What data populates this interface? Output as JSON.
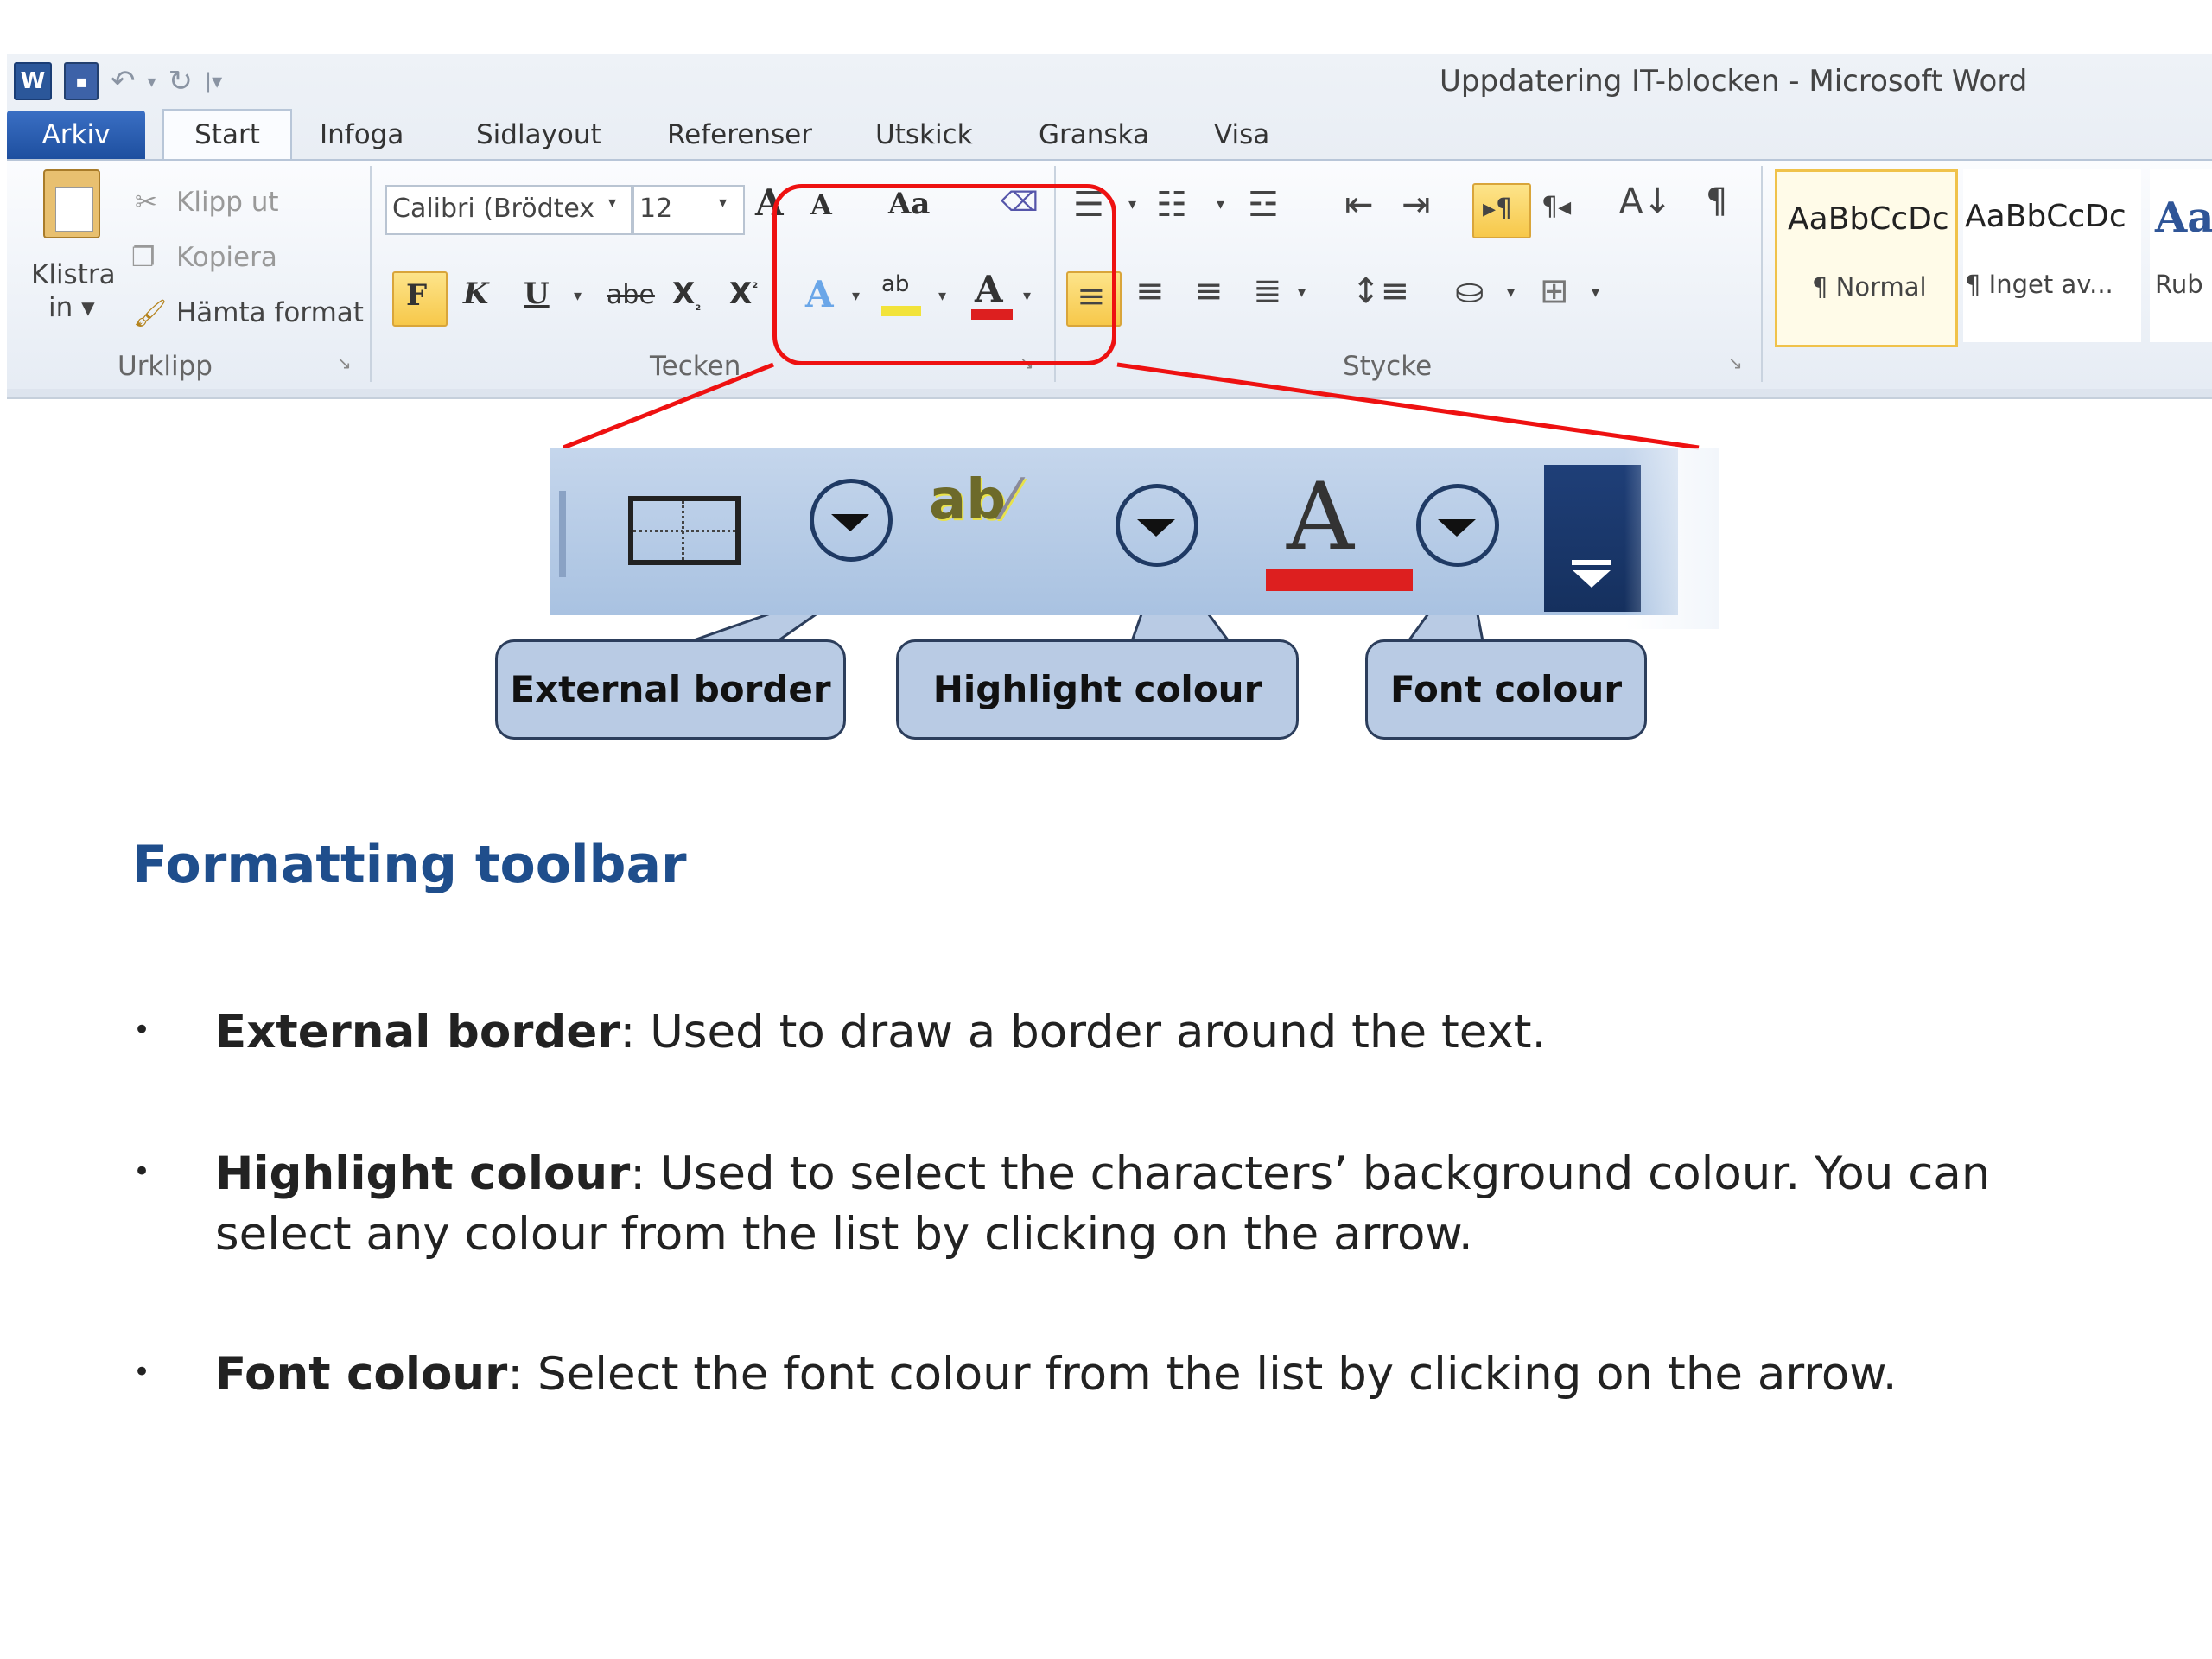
{
  "window": {
    "title": "Uppdatering IT-blocken  -  Microsoft Word"
  },
  "tabs": [
    "Arkiv",
    "Start",
    "Infoga",
    "Sidlayout",
    "Referenser",
    "Utskick",
    "Granska",
    "Visa"
  ],
  "clipboard": {
    "paste_line1": "Klistra",
    "paste_line2": "in ▾",
    "cut": "Klipp ut",
    "copy": "Kopiera",
    "format_painter": "Hämta format",
    "group_label": "Urklipp"
  },
  "font": {
    "font_name": "Calibri (Brödtex",
    "font_size": "12",
    "bold": "F",
    "italic": "K",
    "underline": "U",
    "strike": "abe",
    "grow": "A",
    "shrink": "A",
    "change_case": "Aa",
    "highlight": "ab",
    "font_color": "A",
    "group_label": "Tecken"
  },
  "paragraph": {
    "group_label": "Stycke"
  },
  "styles": [
    {
      "sample": "AaBbCcDc",
      "name": "¶ Normal"
    },
    {
      "sample": "AaBbCcDc",
      "name": "¶ Inget av..."
    },
    {
      "sample": "AaI",
      "name": "Rub"
    }
  ],
  "zoom": {
    "highlight_glyph": "ab",
    "font_glyph": "A"
  },
  "callouts": [
    "External border",
    "Highlight colour",
    "Font colour"
  ],
  "content": {
    "heading": "Formatting toolbar",
    "bullets": [
      {
        "term": "External border",
        "text": ": Used to draw a border around the text."
      },
      {
        "term": "Highlight colour",
        "text": ": Used to select the characters’ background colour. You can select any colour from the list by clicking on the arrow."
      },
      {
        "term": "Font colour",
        "text": ": Select the font colour from the list by clicking on the arrow."
      }
    ]
  },
  "colors": {
    "accent_red": "#e11111",
    "heading_blue": "#1f4e8c",
    "bubble_fill": "#b9cbe4",
    "highlight_yellow": "#f2e33a",
    "font_red": "#dd1f1f"
  }
}
